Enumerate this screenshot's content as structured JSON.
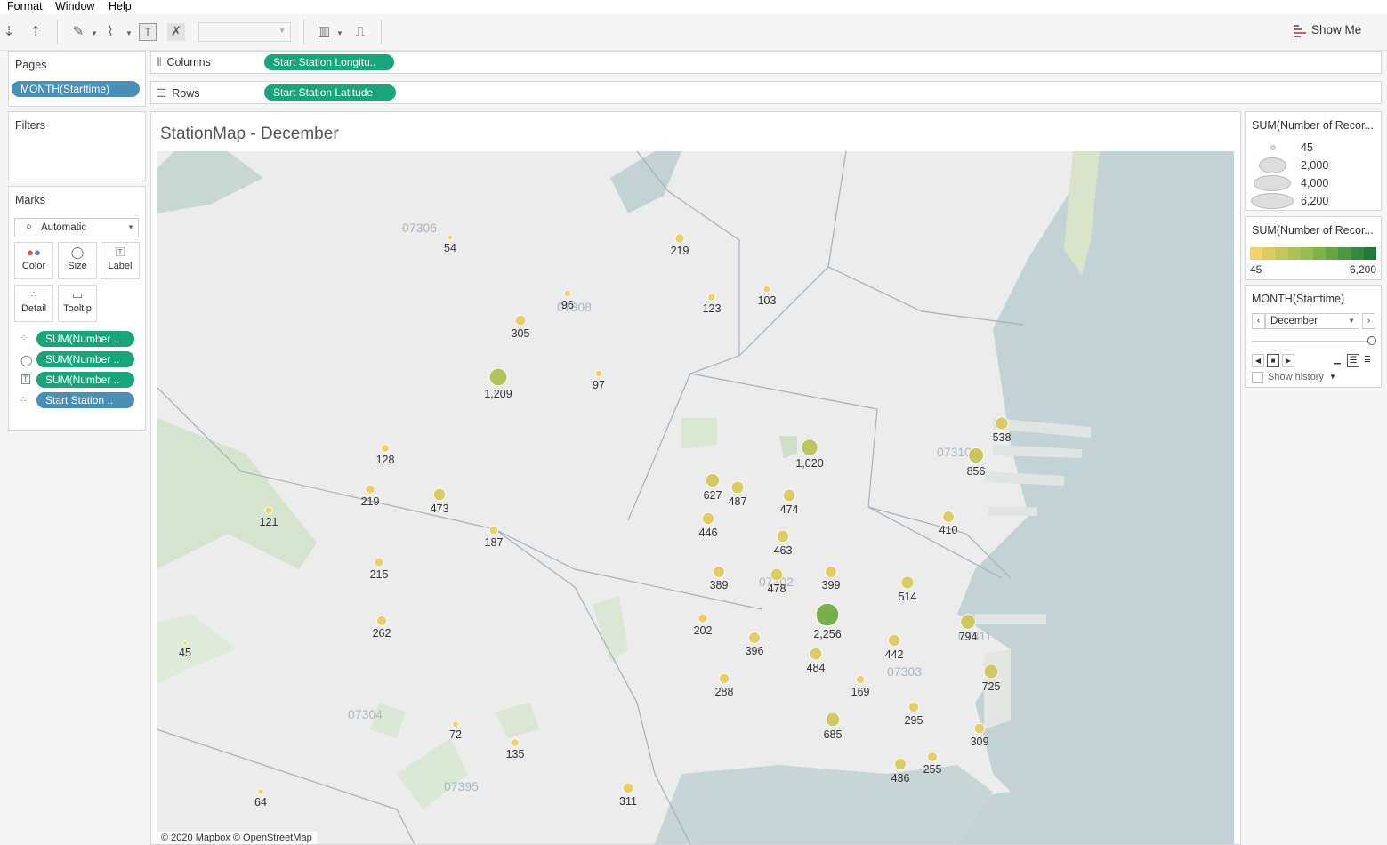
{
  "menu": {
    "format": "Format",
    "window": "Window",
    "help": "Help"
  },
  "toolbar": {
    "show_me_label": "Show Me"
  },
  "pages": {
    "title": "Pages",
    "pill": "MONTH(Starttime)"
  },
  "filters": {
    "title": "Filters"
  },
  "marks": {
    "title": "Marks",
    "mark_type": "Automatic",
    "buttons": {
      "color": "Color",
      "size": "Size",
      "label": "Label",
      "detail": "Detail",
      "tooltip": "Tooltip"
    },
    "pills": [
      "SUM(Number ..",
      "SUM(Number ..",
      "SUM(Number ..",
      "Start Station .."
    ]
  },
  "shelves": {
    "columns_label": "Columns",
    "columns_pill": "Start Station Longitu..",
    "rows_label": "Rows",
    "rows_pill": "Start Station Latitude"
  },
  "view": {
    "title": "StationMap - December",
    "attribution": "© 2020 Mapbox © OpenStreetMap"
  },
  "map": {
    "zip_labels": [
      "07306",
      "07308",
      "07310",
      "07302",
      "07311",
      "07303",
      "07304",
      "07395"
    ],
    "points": [
      {
        "value": 54,
        "label": "54"
      },
      {
        "value": 219,
        "label": "219"
      },
      {
        "value": 96,
        "label": "96"
      },
      {
        "value": 123,
        "label": "123"
      },
      {
        "value": 103,
        "label": "103"
      },
      {
        "value": 305,
        "label": "305"
      },
      {
        "value": 1209,
        "label": "1,209"
      },
      {
        "value": 97,
        "label": "97"
      },
      {
        "value": 128,
        "label": "128"
      },
      {
        "value": 219,
        "label": "219"
      },
      {
        "value": 473,
        "label": "473"
      },
      {
        "value": 121,
        "label": "121"
      },
      {
        "value": 187,
        "label": "187"
      },
      {
        "value": 215,
        "label": "215"
      },
      {
        "value": 262,
        "label": "262"
      },
      {
        "value": 45,
        "label": "45"
      },
      {
        "value": 72,
        "label": "72"
      },
      {
        "value": 135,
        "label": "135"
      },
      {
        "value": 64,
        "label": "64"
      },
      {
        "value": 311,
        "label": "311"
      },
      {
        "value": 1020,
        "label": "1,020"
      },
      {
        "value": 627,
        "label": "627"
      },
      {
        "value": 487,
        "label": "487"
      },
      {
        "value": 474,
        "label": "474"
      },
      {
        "value": 446,
        "label": "446"
      },
      {
        "value": 463,
        "label": "463"
      },
      {
        "value": 389,
        "label": "389"
      },
      {
        "value": 478,
        "label": "478"
      },
      {
        "value": 399,
        "label": "399"
      },
      {
        "value": 2256,
        "label": "2,256"
      },
      {
        "value": 202,
        "label": "202"
      },
      {
        "value": 396,
        "label": "396"
      },
      {
        "value": 484,
        "label": "484"
      },
      {
        "value": 288,
        "label": "288"
      },
      {
        "value": 169,
        "label": "169"
      },
      {
        "value": 685,
        "label": "685"
      },
      {
        "value": 442,
        "label": "442"
      },
      {
        "value": 514,
        "label": "514"
      },
      {
        "value": 295,
        "label": "295"
      },
      {
        "value": 538,
        "label": "538"
      },
      {
        "value": 856,
        "label": "856"
      },
      {
        "value": 410,
        "label": "410"
      },
      {
        "value": 794,
        "label": "794"
      },
      {
        "value": 725,
        "label": "725"
      },
      {
        "value": 309,
        "label": "309"
      },
      {
        "value": 436,
        "label": "436"
      },
      {
        "value": 255,
        "label": "255"
      }
    ]
  },
  "legend_size": {
    "title": "SUM(Number of Recor...",
    "items": [
      "45",
      "2,000",
      "4,000",
      "6,200"
    ]
  },
  "legend_color": {
    "title": "SUM(Number of Recor...",
    "min_label": "45",
    "max_label": "6,200",
    "color_low": "#f3d26b",
    "color_high": "#1e7a3c"
  },
  "page_control": {
    "title": "MONTH(Starttime)",
    "selected": "December",
    "show_history": "Show history"
  },
  "colors": {
    "accent_green": "#17a57b",
    "accent_blue": "#4a8fb5",
    "water": "#c3d2d4"
  }
}
